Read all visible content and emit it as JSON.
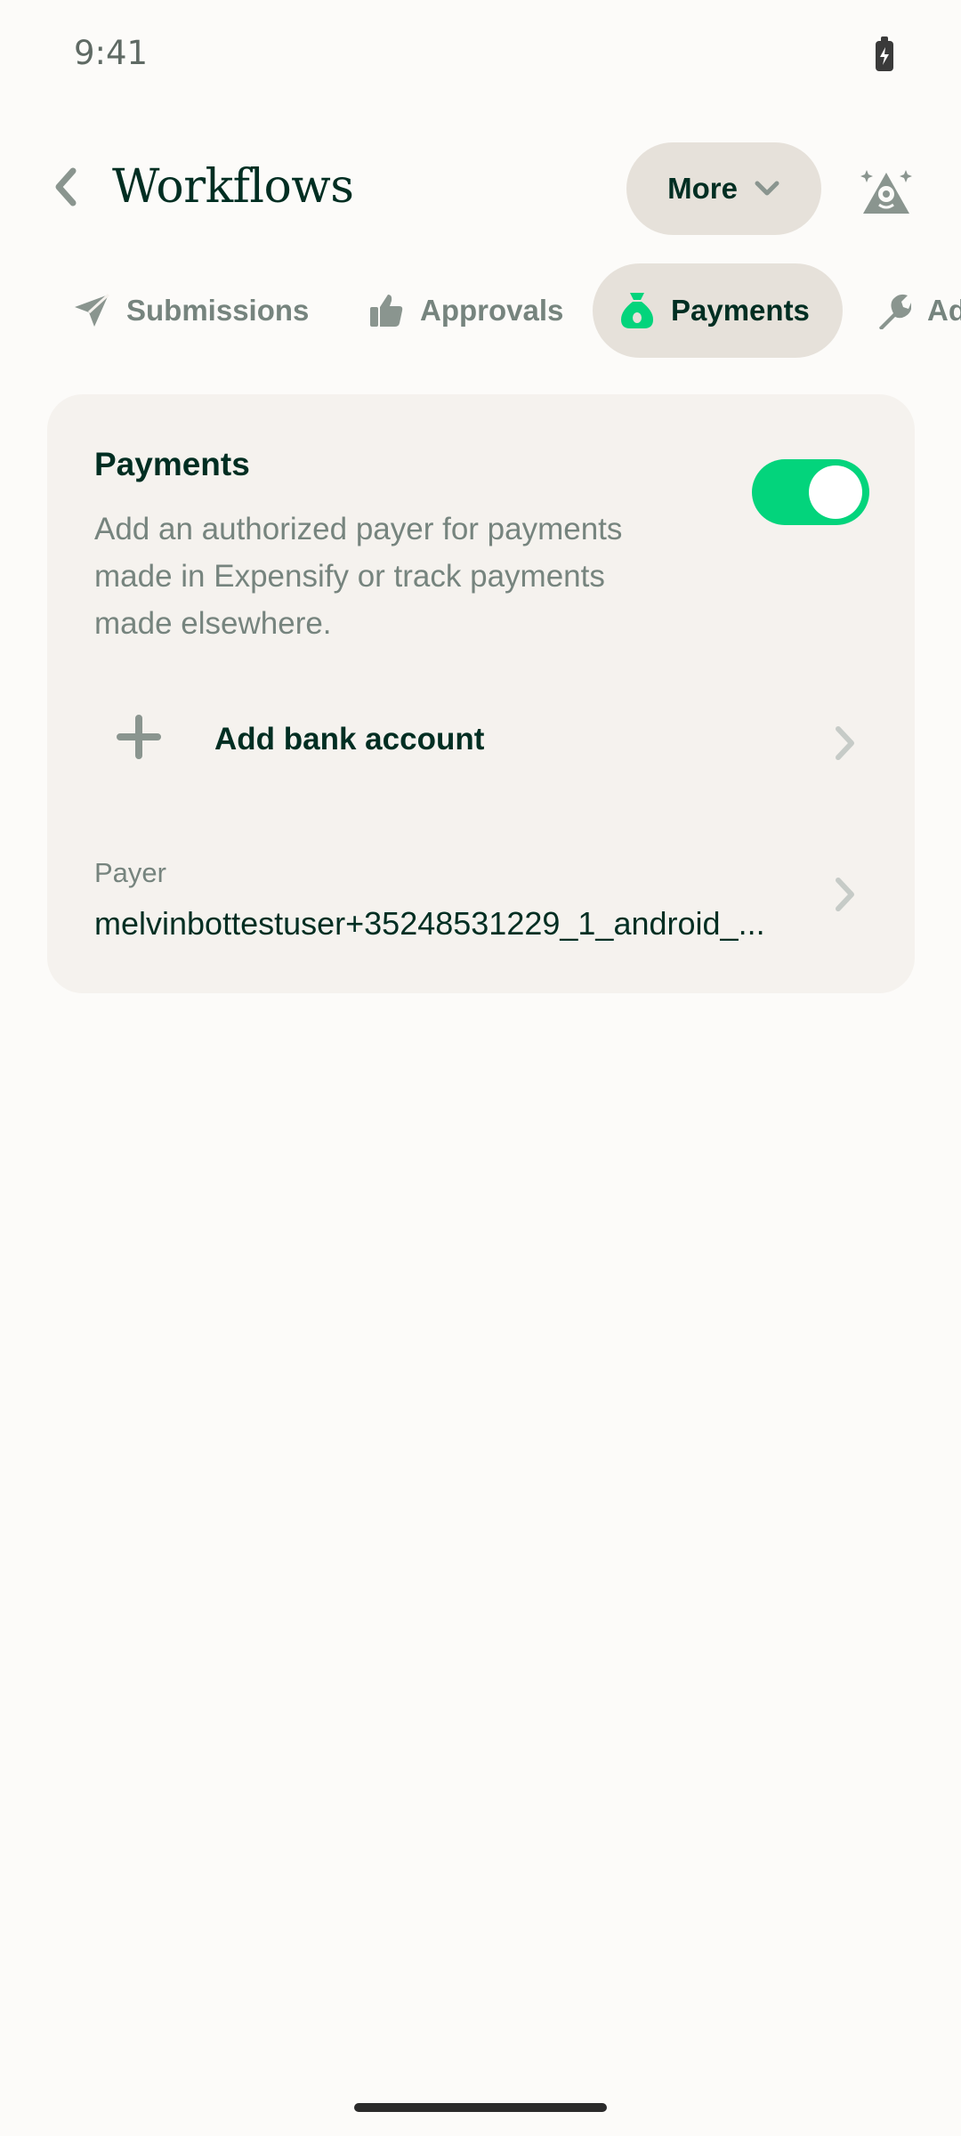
{
  "status_bar": {
    "time": "9:41",
    "battery_icon": "battery-charging-icon"
  },
  "header": {
    "title": "Workflows",
    "back_icon": "chevron-left-icon",
    "more_label": "More",
    "more_icon": "chevron-down-icon",
    "avatar_icon": "concierge-avatar-icon"
  },
  "tabs": [
    {
      "label": "Submissions",
      "icon": "paper-plane-icon",
      "active": false
    },
    {
      "label": "Approvals",
      "icon": "thumbs-up-icon",
      "active": false
    },
    {
      "label": "Payments",
      "icon": "money-bag-icon",
      "active": true
    },
    {
      "label": "Ad",
      "icon": "wrench-icon",
      "active": false
    }
  ],
  "payments_card": {
    "title": "Payments",
    "description": "Add an authorized payer for payments made in Expensify or track payments made elsewhere.",
    "toggle_on": true,
    "add_bank_label": "Add bank account",
    "payer_label": "Payer",
    "payer_value": "melvinbottestuser+35248531229_1_android_..."
  },
  "colors": {
    "accent_green": "#03D47C",
    "text_dark": "#002E22",
    "text_muted": "#76847E",
    "card_bg": "#F5F2EE",
    "pill_bg": "#E6E1DA"
  }
}
